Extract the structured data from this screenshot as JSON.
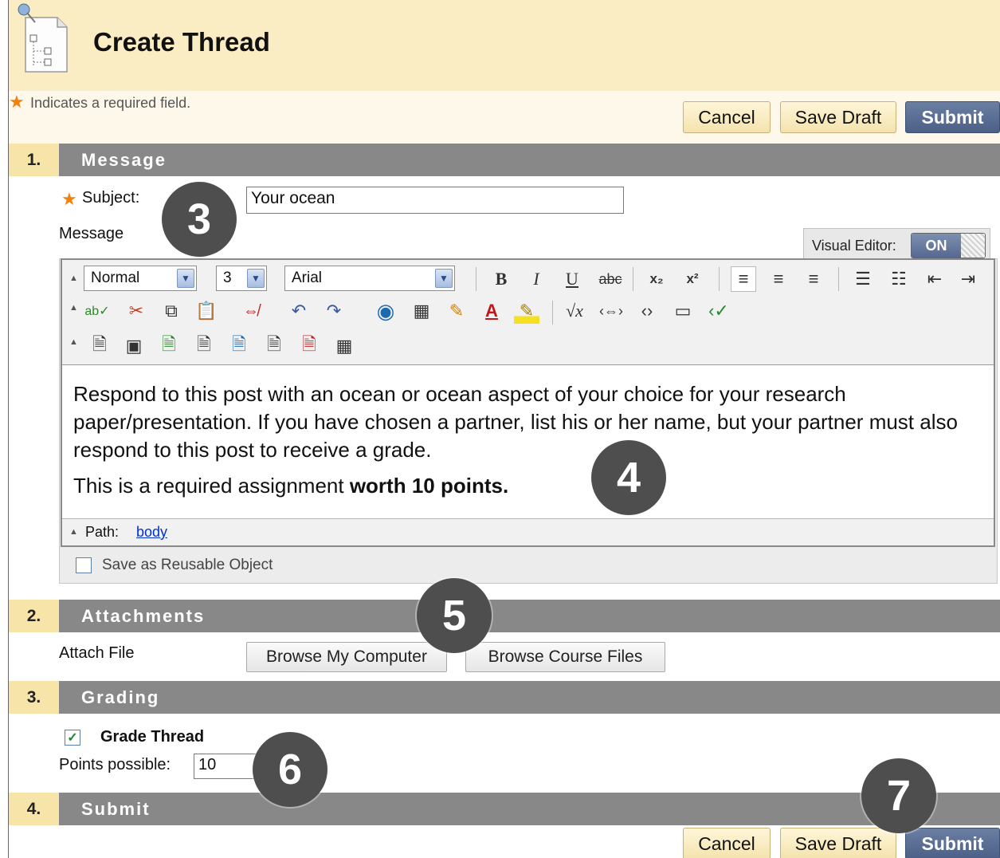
{
  "header": {
    "title": "Create Thread",
    "page_icon": "document-pin-icon"
  },
  "required_note": {
    "star": "★",
    "text": "Indicates a required field."
  },
  "top_actions": {
    "cancel": "Cancel",
    "save_draft": "Save Draft",
    "submit": "Submit"
  },
  "sections": [
    {
      "number": "1.",
      "title": "Message"
    },
    {
      "number": "2.",
      "title": "Attachments"
    },
    {
      "number": "3.",
      "title": "Grading"
    },
    {
      "number": "4.",
      "title": "Submit"
    }
  ],
  "message": {
    "subject_label": "Subject:",
    "subject_value": "Your ocean",
    "message_label": "Message"
  },
  "visual_editor": {
    "label": "Visual Editor:",
    "state": "ON"
  },
  "toolbar": {
    "format": "Normal",
    "size": "3",
    "font": "Arial",
    "bold": "B",
    "italic": "I",
    "underline": "U",
    "strike": "abc",
    "subscript": "x₂",
    "superscript": "x²"
  },
  "editor_content": {
    "paragraph1": "Respond to this post with an ocean or ocean aspect of your choice for your research paper/presentation. If you have chosen a partner, list his or her name, but your partner must also respond to this post to receive a grade.",
    "paragraph2_normal": "This is a required assignment ",
    "paragraph2_bold": "worth 10 points."
  },
  "path": {
    "label": "Path:",
    "link": "body"
  },
  "reusable": {
    "label": "Save as Reusable Object",
    "checked": false
  },
  "attachments": {
    "label": "Attach File",
    "browse_computer": "Browse My Computer",
    "browse_course": "Browse Course Files"
  },
  "grading": {
    "grade_thread_label": "Grade Thread",
    "grade_thread_checked": true,
    "points_label": "Points possible:",
    "points_value": "10"
  },
  "bottom_actions": {
    "cancel": "Cancel",
    "save_draft": "Save Draft",
    "submit": "Submit"
  },
  "markers": [
    "3",
    "4",
    "5",
    "6",
    "7"
  ],
  "colors": {
    "header_bg": "#fbedc3",
    "section_bar": "#888888",
    "section_number_bg": "#f6e4a8",
    "submit_button": "#56688f",
    "required_star": "#f0820a",
    "marker": "#4e4e4e"
  }
}
